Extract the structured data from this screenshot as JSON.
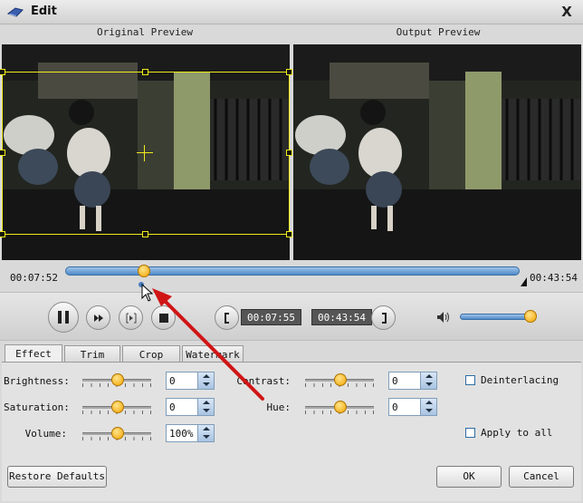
{
  "window": {
    "title": "Edit",
    "close_glyph": "X"
  },
  "preview": {
    "original_label": "Original Preview",
    "output_label": "Output Preview"
  },
  "playback": {
    "current_time": "00:07:52",
    "total_time": "00:43:54",
    "progress": 0.175,
    "clip_start": "00:07:55",
    "clip_end": "00:43:54",
    "volume_level": 0.92
  },
  "tabs": [
    {
      "label": "Effect",
      "active": true
    },
    {
      "label": "Trim",
      "active": false
    },
    {
      "label": "Crop",
      "active": false
    },
    {
      "label": "Watermark",
      "active": false
    }
  ],
  "effect": {
    "brightness": {
      "label": "Brightness:",
      "value": "0"
    },
    "saturation": {
      "label": "Saturation:",
      "value": "0"
    },
    "volume": {
      "label": "Volume:",
      "value": "100%"
    },
    "contrast": {
      "label": "Contrast:",
      "value": "0"
    },
    "hue": {
      "label": "Hue:",
      "value": "0"
    },
    "deinterlacing": {
      "label": "Deinterlacing",
      "checked": false
    },
    "apply_all": {
      "label": "Apply to all",
      "checked": false
    }
  },
  "buttons": {
    "restore": "Restore Defaults",
    "ok": "OK",
    "cancel": "Cancel"
  },
  "colors": {
    "accent_blue": "#4f8ac9",
    "crop_yellow": "#f0ea1a",
    "knob_orange": "#f2a300",
    "annotation_red": "#d01515"
  },
  "icons": [
    "app-icon",
    "close-icon",
    "pause-icon",
    "fast-forward-icon",
    "step-frame-icon",
    "stop-icon",
    "set-start-bracket-icon",
    "set-end-bracket-icon",
    "volume-speaker-icon",
    "mouse-cursor-icon"
  ]
}
